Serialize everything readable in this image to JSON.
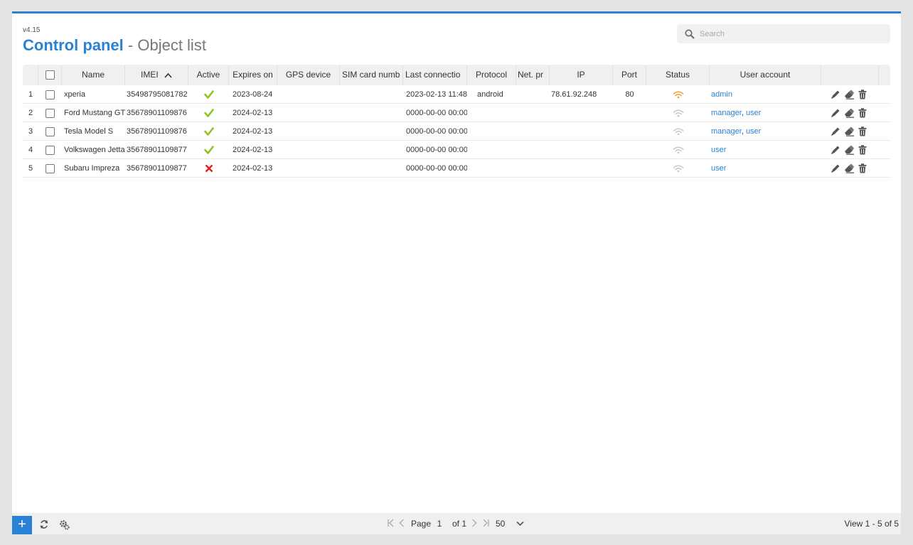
{
  "header": {
    "version": "v4.15",
    "title_main": "Control panel",
    "title_sub": "- Object list",
    "search_placeholder": "Search"
  },
  "columns": [
    "Name",
    "IMEI",
    "Active",
    "Expires on",
    "GPS device",
    "SIM card numb",
    "Last connectio",
    "Protocol",
    "Net. pr",
    "IP",
    "Port",
    "Status",
    "User account"
  ],
  "rows": [
    {
      "num": "1",
      "name": "xperia",
      "imei": "35498795081782",
      "active": true,
      "expires": "2023-08-24",
      "gps": "",
      "sim": "",
      "last": "2023-02-13 11:48",
      "protocol": "android",
      "net": "",
      "ip": "78.61.92.248",
      "port": "80",
      "status": "online",
      "users": [
        "admin"
      ]
    },
    {
      "num": "2",
      "name": "Ford Mustang GT",
      "imei": "35678901109876",
      "active": true,
      "expires": "2024-02-13",
      "gps": "",
      "sim": "",
      "last": "0000-00-00 00:00",
      "protocol": "",
      "net": "",
      "ip": "",
      "port": "",
      "status": "offline",
      "users": [
        "manager",
        "user"
      ]
    },
    {
      "num": "3",
      "name": "Tesla Model S",
      "imei": "35678901109876",
      "active": true,
      "expires": "2024-02-13",
      "gps": "",
      "sim": "",
      "last": "0000-00-00 00:00",
      "protocol": "",
      "net": "",
      "ip": "",
      "port": "",
      "status": "offline",
      "users": [
        "manager",
        "user"
      ]
    },
    {
      "num": "4",
      "name": "Volkswagen Jetta",
      "imei": "35678901109877",
      "active": true,
      "expires": "2024-02-13",
      "gps": "",
      "sim": "",
      "last": "0000-00-00 00:00",
      "protocol": "",
      "net": "",
      "ip": "",
      "port": "",
      "status": "offline",
      "users": [
        "user"
      ]
    },
    {
      "num": "5",
      "name": "Subaru Impreza",
      "imei": "35678901109877",
      "active": false,
      "expires": "2024-02-13",
      "gps": "",
      "sim": "",
      "last": "0000-00-00 00:00",
      "protocol": "",
      "net": "",
      "ip": "",
      "port": "",
      "status": "offline",
      "users": [
        "user"
      ]
    }
  ],
  "icons": {
    "active_true": "check-icon",
    "active_false": "cross-icon",
    "status": "wifi-icon",
    "row_actions": [
      "edit-icon",
      "eraser-icon",
      "trash-icon"
    ],
    "sort": "sort-asc-icon"
  },
  "colors": {
    "accent": "#2b82d4",
    "check": "#8fc31f",
    "cross": "#e02020",
    "status_online": "#f0a030",
    "status_offline": "#c8c8c8"
  },
  "footer": {
    "page_label": "Page",
    "page_value": "1",
    "of_label": "of 1",
    "rows_per_page": "50",
    "view_info": "View 1 - 5 of 5"
  }
}
